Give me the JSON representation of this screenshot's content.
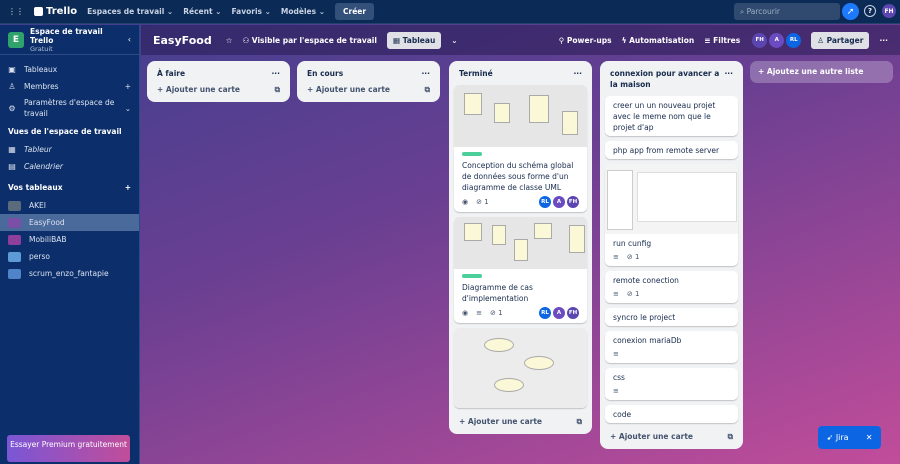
{
  "topbar": {
    "logo": "Trello",
    "nav": [
      "Espaces de travail",
      "Récent",
      "Favoris",
      "Modèles"
    ],
    "create": "Créer",
    "search_placeholder": "Parcourir",
    "user": "FH"
  },
  "sidebar": {
    "workspace": "Espace de travail Trello",
    "plan": "Gratuit",
    "initial": "E",
    "items": [
      {
        "label": "Tableaux",
        "icon": "board-icon"
      },
      {
        "label": "Membres",
        "icon": "person-icon"
      },
      {
        "label": "Paramètres d'espace de travail",
        "icon": "gear-icon"
      }
    ],
    "views_title": "Vues de l'espace de travail",
    "views": [
      "Tableur",
      "Calendrier"
    ],
    "boards_title": "Vos tableaux",
    "boards": [
      {
        "name": "AKEI",
        "color": "#5a6b7d"
      },
      {
        "name": "EasyFood",
        "color": "#7b4fa8"
      },
      {
        "name": "MobiliBAB",
        "color": "#8e3f9c"
      },
      {
        "name": "perso",
        "color": "#5e9ad6"
      },
      {
        "name": "scrum_enzo_fantapie",
        "color": "#4f84c9"
      }
    ],
    "premium": "Essayer Premium gratuitement"
  },
  "board": {
    "title": "EasyFood",
    "visibility": "Visible par l'espace de travail",
    "view": "Tableau",
    "powerups": "Power-ups",
    "automation": "Automatisation",
    "filters": "Filtres",
    "share": "Partager",
    "members": [
      {
        "initials": "FH",
        "color": "#5b45b0"
      },
      {
        "initials": "A",
        "color": "#6a4bc0"
      },
      {
        "initials": "RL",
        "color": "#0c66e4"
      }
    ]
  },
  "lists": [
    {
      "title": "À faire",
      "cards": [],
      "add": "Ajouter une carte"
    },
    {
      "title": "En cours",
      "cards": [],
      "add": "Ajouter une carte"
    },
    {
      "title": "Terminé",
      "add": "Ajouter une carte",
      "cards": [
        {
          "title": "Conception du schéma global de données sous forme d'un diagramme de classe UML",
          "attachments": "1"
        },
        {
          "title": "Diagramme de cas d'implementation",
          "attachments": "1"
        }
      ]
    },
    {
      "title": "connexion pour avancer a la maison",
      "add": "Ajouter une carte",
      "cards": [
        {
          "title": "creer un un nouveau projet avec le meme nom que le projet d'ap"
        },
        {
          "title": "php app from remote server"
        },
        {
          "title": "run cunfig",
          "attachments": "1"
        },
        {
          "title": "remote conection",
          "attachments": "1"
        },
        {
          "title": "syncro le project"
        },
        {
          "title": "conexion mariaDb"
        },
        {
          "title": "css"
        },
        {
          "title": "code"
        }
      ]
    }
  ],
  "add_list": "Ajoutez une autre liste",
  "jira": "Jira"
}
